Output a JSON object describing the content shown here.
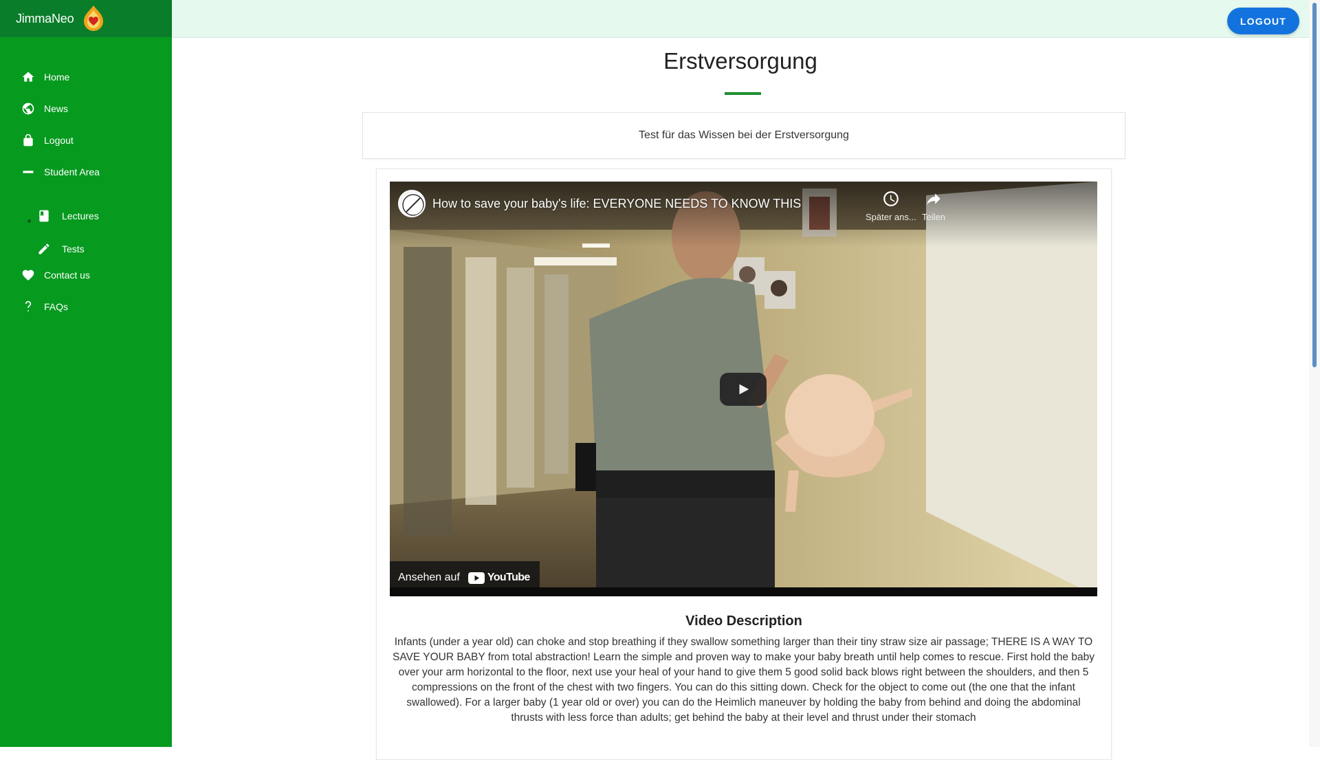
{
  "brand": {
    "name": "JimmaNeo",
    "logo_icon": "jimmaneo-flame-logo-icon"
  },
  "sidebar": {
    "items": [
      {
        "label": "Home",
        "icon": "home-icon"
      },
      {
        "label": "News",
        "icon": "globe-icon"
      },
      {
        "label": "Logout",
        "icon": "lock-icon"
      },
      {
        "label": "Student Area",
        "icon": "minus-icon"
      },
      {
        "label": "Lectures",
        "icon": "book-icon"
      },
      {
        "label": "Tests",
        "icon": "pencil-icon"
      },
      {
        "label": "Contact us",
        "icon": "heart-icon"
      },
      {
        "label": "FAQs",
        "icon": "question-icon"
      }
    ]
  },
  "topbar": {
    "logout_label": "LOGOUT"
  },
  "page": {
    "title": "Erstversorgung",
    "subtitle": "Test für das Wissen bei der Erstversorgung"
  },
  "video": {
    "title": "How to save your baby's life: EVERYONE NEEDS TO KNOW THIS",
    "watch_later_label": "Später ans...",
    "share_label": "Teilen",
    "watch_on_label": "Ansehen auf",
    "youtube_label": "YouTube"
  },
  "description": {
    "heading": "Video Description",
    "text": "Infants (under a year old) can choke and stop breathing if they swallow something larger than their tiny straw size air passage; THERE IS A WAY TO SAVE YOUR BABY from total abstraction! Learn the simple and proven way to make your baby breath until help comes to rescue. First hold the baby over your arm horizontal to the floor, next use your heal of your hand to give them 5 good solid back blows right between the shoulders, and then 5 compressions on the front of the chest with two fingers. You can do this sitting down. Check for the object to come out (the one that the infant swallowed). For a larger baby (1 year old or over) you can do the Heimlich maneuver by holding the baby from behind and doing the abdominal thrusts with less force than adults; get behind the baby at their level and thrust under their stomach"
  },
  "colors": {
    "sidebar_green": "#069a1f",
    "brand_green": "#0a7d2a",
    "topbar_mint": "#e5f9ef",
    "logout_blue": "#1273de",
    "accent_underline": "#1e8f2f"
  }
}
